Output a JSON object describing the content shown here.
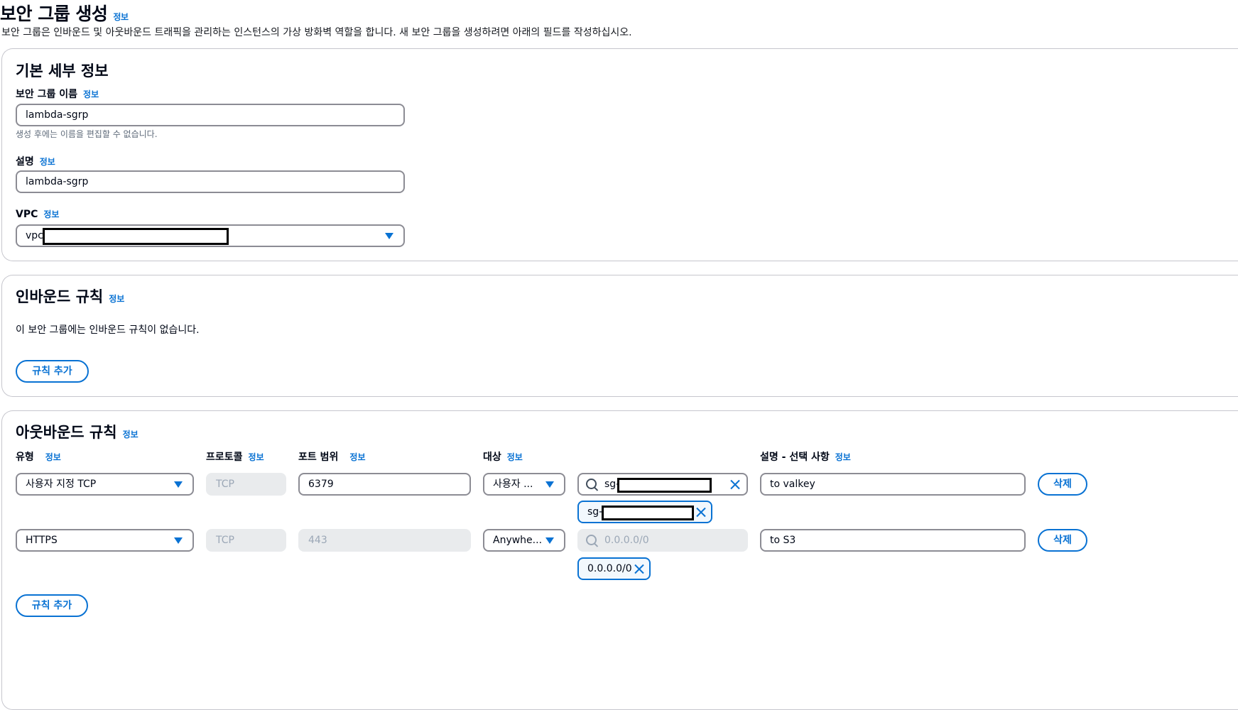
{
  "page": {
    "title": "보안 그룹 생성",
    "info": "정보",
    "subtitle": "보안 그룹은 인바운드 및 아웃바운드 트래픽을 관리하는 인스턴스의 가상 방화벽 역할을 합니다. 새 보안 그룹을 생성하려면 아래의 필드를 작성하십시오."
  },
  "basic": {
    "heading": "기본 세부 정보",
    "name_label": "보안 그룹 이름",
    "name_value": "lambda-sgrp",
    "name_hint": "생성 후에는 이름을 편집할 수 없습니다.",
    "desc_label": "설명",
    "desc_value": "lambda-sgrp",
    "vpc_label": "VPC",
    "vpc_prefix": "vpc-"
  },
  "inbound": {
    "heading": "인바운드 규칙",
    "empty_text": "이 보안 그룹에는 인바운드 규칙이 없습니다.",
    "add_rule": "규칙 추가"
  },
  "outbound": {
    "heading": "아웃바운드 규칙",
    "columns": {
      "type": "유형",
      "protocol": "프로토콜",
      "port": "포트 범위",
      "dest": "대상",
      "desc": "설명 - 선택 사항"
    },
    "rows": [
      {
        "type": "사용자 지정 TCP",
        "protocol": "TCP",
        "port": "6379",
        "dest_type": "사용자 ...",
        "search_value": "sg-",
        "token": "sg-",
        "description": "to valkey",
        "delete": "삭제"
      },
      {
        "type": "HTTPS",
        "protocol": "TCP",
        "port": "443",
        "dest_type": "Anywhe...",
        "search_placeholder": "0.0.0.0/0",
        "token": "0.0.0.0/0",
        "description": "to S3",
        "delete": "삭제"
      }
    ],
    "add_rule": "규칙 추가"
  },
  "colors": {
    "accent": "#0972d3",
    "border": "#8c8c94",
    "disabled_bg": "#e9ebed"
  }
}
